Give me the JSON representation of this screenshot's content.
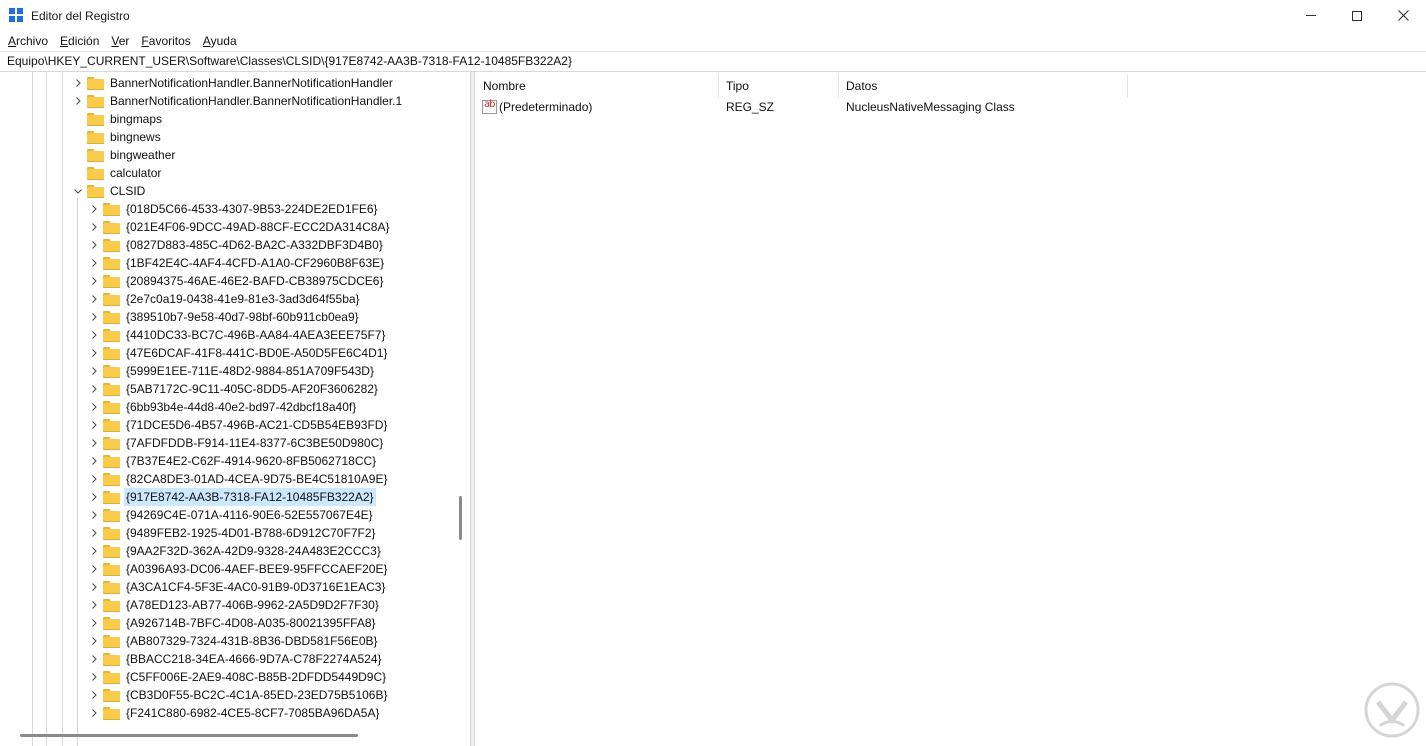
{
  "window": {
    "title": "Editor del Registro",
    "icon": "registry-editor-icon",
    "controls": [
      "minimize-icon",
      "maximize-icon",
      "close-icon"
    ]
  },
  "menu": [
    "Archivo",
    "Edición",
    "Ver",
    "Favoritos",
    "Ayuda"
  ],
  "address": "Equipo\\HKEY_CURRENT_USER\\Software\\Classes\\CLSID\\{917E8742-AA3B-7318-FA12-10485FB322A2}",
  "tree": [
    {
      "label": "BannerNotificationHandler.BannerNotificationHandler",
      "level": 0,
      "expander": "right"
    },
    {
      "label": "BannerNotificationHandler.BannerNotificationHandler.1",
      "level": 0,
      "expander": "right"
    },
    {
      "label": "bingmaps",
      "level": 0,
      "expander": "none"
    },
    {
      "label": "bingnews",
      "level": 0,
      "expander": "none"
    },
    {
      "label": "bingweather",
      "level": 0,
      "expander": "none"
    },
    {
      "label": "calculator",
      "level": 0,
      "expander": "none"
    },
    {
      "label": "CLSID",
      "level": 0,
      "expander": "down"
    },
    {
      "label": "{018D5C66-4533-4307-9B53-224DE2ED1FE6}",
      "level": 1,
      "expander": "right"
    },
    {
      "label": "{021E4F06-9DCC-49AD-88CF-ECC2DA314C8A}",
      "level": 1,
      "expander": "right"
    },
    {
      "label": "{0827D883-485C-4D62-BA2C-A332DBF3D4B0}",
      "level": 1,
      "expander": "right"
    },
    {
      "label": "{1BF42E4C-4AF4-4CFD-A1A0-CF2960B8F63E}",
      "level": 1,
      "expander": "right"
    },
    {
      "label": "{20894375-46AE-46E2-BAFD-CB38975CDCE6}",
      "level": 1,
      "expander": "right"
    },
    {
      "label": "{2e7c0a19-0438-41e9-81e3-3ad3d64f55ba}",
      "level": 1,
      "expander": "right"
    },
    {
      "label": "{389510b7-9e58-40d7-98bf-60b911cb0ea9}",
      "level": 1,
      "expander": "right"
    },
    {
      "label": "{4410DC33-BC7C-496B-AA84-4AEA3EEE75F7}",
      "level": 1,
      "expander": "right"
    },
    {
      "label": "{47E6DCAF-41F8-441C-BD0E-A50D5FE6C4D1}",
      "level": 1,
      "expander": "right"
    },
    {
      "label": "{5999E1EE-711E-48D2-9884-851A709F543D}",
      "level": 1,
      "expander": "right"
    },
    {
      "label": "{5AB7172C-9C11-405C-8DD5-AF20F3606282}",
      "level": 1,
      "expander": "right"
    },
    {
      "label": "{6bb93b4e-44d8-40e2-bd97-42dbcf18a40f}",
      "level": 1,
      "expander": "right"
    },
    {
      "label": "{71DCE5D6-4B57-496B-AC21-CD5B54EB93FD}",
      "level": 1,
      "expander": "right"
    },
    {
      "label": "{7AFDFDDB-F914-11E4-8377-6C3BE50D980C}",
      "level": 1,
      "expander": "right"
    },
    {
      "label": "{7B37E4E2-C62F-4914-9620-8FB5062718CC}",
      "level": 1,
      "expander": "right"
    },
    {
      "label": "{82CA8DE3-01AD-4CEA-9D75-BE4C51810A9E}",
      "level": 1,
      "expander": "right"
    },
    {
      "label": "{917E8742-AA3B-7318-FA12-10485FB322A2}",
      "level": 1,
      "expander": "right",
      "selected": true
    },
    {
      "label": "{94269C4E-071A-4116-90E6-52E557067E4E}",
      "level": 1,
      "expander": "right"
    },
    {
      "label": "{9489FEB2-1925-4D01-B788-6D912C70F7F2}",
      "level": 1,
      "expander": "right"
    },
    {
      "label": "{9AA2F32D-362A-42D9-9328-24A483E2CCC3}",
      "level": 1,
      "expander": "right"
    },
    {
      "label": "{A0396A93-DC06-4AEF-BEE9-95FFCCAEF20E}",
      "level": 1,
      "expander": "right"
    },
    {
      "label": "{A3CA1CF4-5F3E-4AC0-91B9-0D3716E1EAC3}",
      "level": 1,
      "expander": "right"
    },
    {
      "label": "{A78ED123-AB77-406B-9962-2A5D9D2F7F30}",
      "level": 1,
      "expander": "right"
    },
    {
      "label": "{A926714B-7BFC-4D08-A035-80021395FFA8}",
      "level": 1,
      "expander": "right"
    },
    {
      "label": "{AB807329-7324-431B-8B36-DBD581F56E0B}",
      "level": 1,
      "expander": "right"
    },
    {
      "label": "{BBACC218-34EA-4666-9D7A-C78F2274A524}",
      "level": 1,
      "expander": "right"
    },
    {
      "label": "{C5FF006E-2AE9-408C-B85B-2DFDD5449D9C}",
      "level": 1,
      "expander": "right"
    },
    {
      "label": "{CB3D0F55-BC2C-4C1A-85ED-23ED75B5106B}",
      "level": 1,
      "expander": "right"
    },
    {
      "label": "{F241C880-6982-4CE5-8CF7-7085BA96DA5A}",
      "level": 1,
      "expander": "right"
    }
  ],
  "values": {
    "columns": {
      "name": "Nombre",
      "type": "Tipo",
      "data": "Datos"
    },
    "rows": [
      {
        "icon": "string-value-icon",
        "icon_text": "ab",
        "name": "(Predeterminado)",
        "type": "REG_SZ",
        "data": "NucleusNativeMessaging Class"
      }
    ]
  },
  "watermark_icon": "solvetic-logo-icon"
}
